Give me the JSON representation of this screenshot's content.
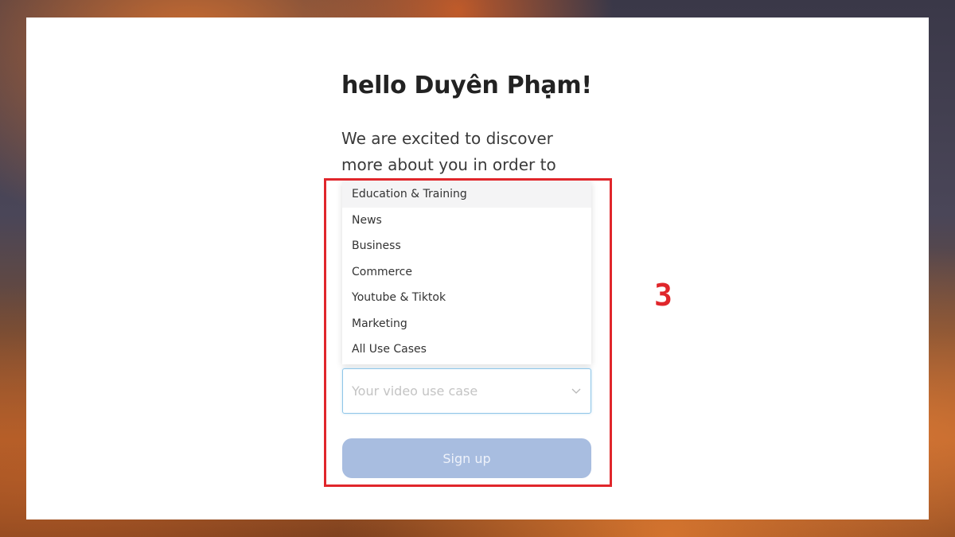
{
  "greeting": "hello Duyên Phạm!",
  "intro": {
    "line1": "We are excited to discover",
    "line2": "more about you in order to"
  },
  "use_case_dropdown": {
    "options": [
      "Education & Training",
      "News",
      "Business",
      "Commerce",
      "Youtube & Tiktok",
      "Marketing",
      "All Use Cases"
    ],
    "placeholder": "Your video use case",
    "icon": "chevron-down-icon"
  },
  "signup_button": {
    "label": "Sign up"
  },
  "annotation": {
    "step_number": "3",
    "color": "#e0262b"
  },
  "colors": {
    "button_bg": "#a8bde0",
    "select_border": "#8fc6e8"
  }
}
